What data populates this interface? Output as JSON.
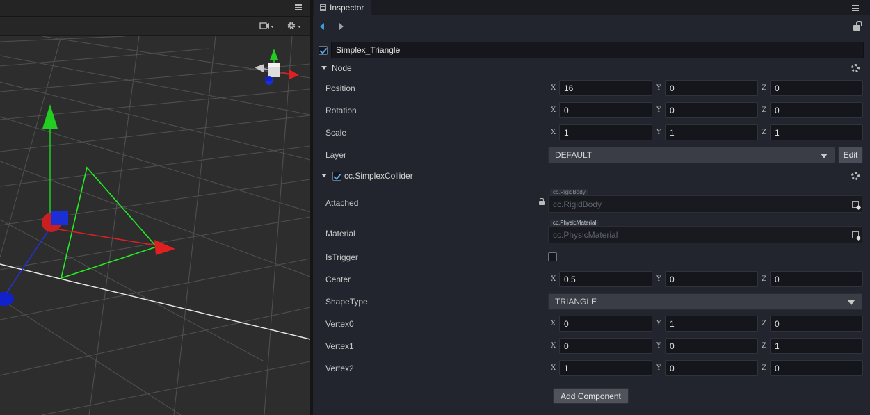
{
  "inspector": {
    "tab_title": "Inspector",
    "node_name": "Simplex_Triangle",
    "node_enabled": true
  },
  "node_section": {
    "title": "Node",
    "position": {
      "label": "Position",
      "x": "16",
      "y": "0",
      "z": "0"
    },
    "rotation": {
      "label": "Rotation",
      "x": "0",
      "y": "0",
      "z": "0"
    },
    "scale": {
      "label": "Scale",
      "x": "1",
      "y": "1",
      "z": "1"
    },
    "layer": {
      "label": "Layer",
      "value": "DEFAULT",
      "edit_label": "Edit"
    }
  },
  "collider": {
    "title": "cc.SimplexCollider",
    "enabled": true,
    "attached": {
      "label": "Attached",
      "tag": "cc.RigidBody",
      "placeholder": "cc.RigidBody"
    },
    "material": {
      "label": "Material",
      "tag": "cc.PhysicMaterial",
      "placeholder": "cc.PhysicMaterial"
    },
    "is_trigger": {
      "label": "IsTrigger",
      "checked": false
    },
    "center": {
      "label": "Center",
      "x": "0.5",
      "y": "0",
      "z": "0"
    },
    "shape_type": {
      "label": "ShapeType",
      "value": "TRIANGLE"
    },
    "vertex0": {
      "label": "Vertex0",
      "x": "0",
      "y": "1",
      "z": "0"
    },
    "vertex1": {
      "label": "Vertex1",
      "x": "0",
      "y": "0",
      "z": "1"
    },
    "vertex2": {
      "label": "Vertex2",
      "x": "1",
      "y": "0",
      "z": "0"
    }
  },
  "axes": {
    "x": "X",
    "y": "Y",
    "z": "Z"
  },
  "add_component_label": "Add Component",
  "colors": {
    "accent": "#3b9ae0",
    "gizmo_x": "#e02020",
    "gizmo_y": "#22cc22",
    "gizmo_z": "#1a2fd6",
    "triangle": "#22ee22"
  },
  "icons": [
    "menu-icon",
    "camera-icon",
    "gear-icon",
    "back-arrow-icon",
    "forward-arrow-icon",
    "lock-icon",
    "checkbox-icon",
    "caret-down-icon",
    "object-picker-icon"
  ]
}
